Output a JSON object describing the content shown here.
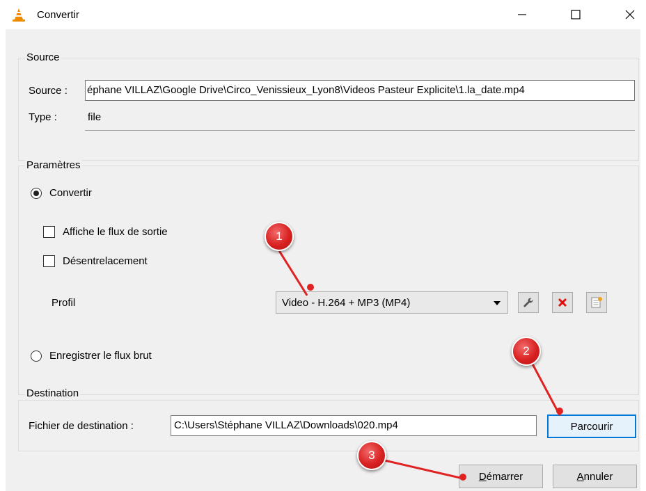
{
  "window": {
    "title": "Convertir",
    "icon": "vlc-cone-icon",
    "controls": {
      "minimize": "—",
      "maximize": "☐",
      "close": "✕"
    }
  },
  "source": {
    "legend": "Source",
    "source_label": "Source :",
    "source_value": "éphane VILLAZ\\Google Drive\\Circo_Venissieux_Lyon8\\Videos Pasteur Explicite\\1.la_date.mp4",
    "type_label": "Type :",
    "type_value": "file"
  },
  "parametres": {
    "legend": "Paramètres",
    "convert_radio": {
      "label": "Convertir",
      "selected": true
    },
    "show_output_checkbox": {
      "label": "Affiche le flux de sortie",
      "checked": false
    },
    "deinterlace_checkbox": {
      "label": "Désentrelacement",
      "checked": false
    },
    "profile_label": "Profil",
    "profile_value": "Video - H.264 + MP3 (MP4)",
    "profile_buttons": [
      "wrench-icon",
      "delete-x-icon",
      "new-profile-icon"
    ],
    "raw_radio": {
      "label": "Enregistrer le flux brut",
      "selected": false
    }
  },
  "destination": {
    "legend": "Destination",
    "file_label": "Fichier de destination :",
    "file_value": "C:\\Users\\Stéphane VILLAZ\\Downloads\\020.mp4",
    "browse_button": "Parcourir"
  },
  "footer": {
    "start_button_first": "D",
    "start_button_rest": "émarrer",
    "cancel_button_first": "A",
    "cancel_button_rest": "nnuler"
  },
  "annotations": [
    {
      "number": "1"
    },
    {
      "number": "2"
    },
    {
      "number": "3"
    }
  ],
  "colors": {
    "annotation": "#e02222",
    "focus_border": "#0078d7"
  }
}
